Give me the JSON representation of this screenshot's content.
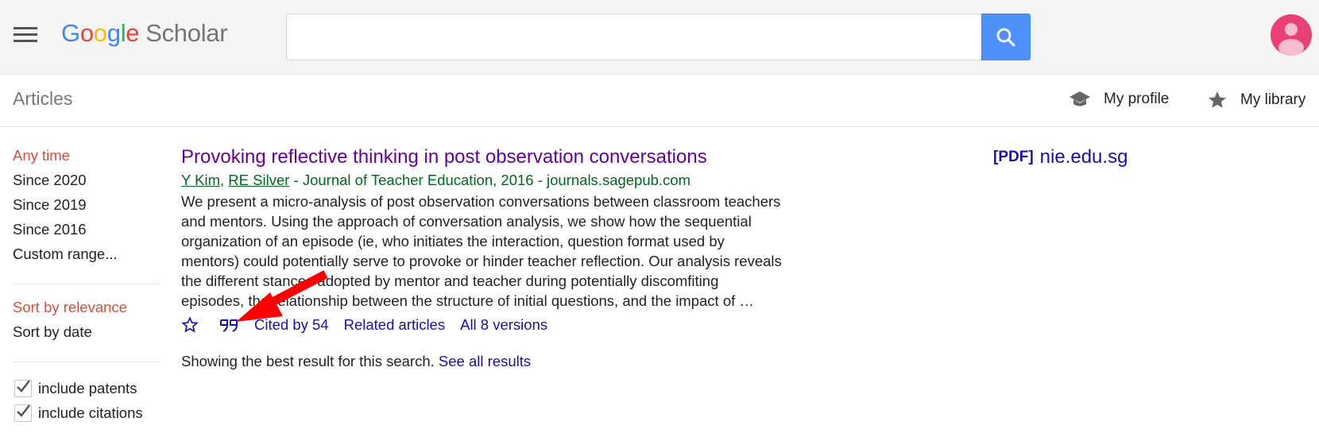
{
  "header": {
    "menu_icon": "hamburger-menu-icon",
    "logo": {
      "google_letters": [
        "G",
        "o",
        "o",
        "g",
        "l",
        "e"
      ],
      "product": "Scholar"
    },
    "search": {
      "value": "",
      "placeholder": ""
    },
    "search_button_icon": "search-icon",
    "avatar_icon": "account-avatar-icon"
  },
  "subheader": {
    "section_label": "Articles",
    "my_profile": {
      "label": "My profile",
      "icon": "graduation-cap-icon"
    },
    "my_library": {
      "label": "My library",
      "icon": "star-icon"
    }
  },
  "sidebar": {
    "time_filters": [
      {
        "label": "Any time",
        "active": true
      },
      {
        "label": "Since 2020",
        "active": false
      },
      {
        "label": "Since 2019",
        "active": false
      },
      {
        "label": "Since 2016",
        "active": false
      },
      {
        "label": "Custom range...",
        "active": false
      }
    ],
    "sort_options": [
      {
        "label": "Sort by relevance",
        "active": true
      },
      {
        "label": "Sort by date",
        "active": false
      }
    ],
    "checkboxes": [
      {
        "label": "include patents",
        "checked": true
      },
      {
        "label": "include citations",
        "checked": true
      }
    ]
  },
  "result": {
    "title": "Provoking reflective thinking in post observation conversations",
    "authors": [
      "Y Kim",
      "RE Silver"
    ],
    "author_separator": ", ",
    "meta_rest": " - Journal of Teacher Education, 2016 - journals.sagepub.com",
    "snippet_lines": [
      "We present a micro-analysis of post observation conversations between classroom teachers",
      "and mentors. Using the approach of conversation analysis, we show how the sequential",
      "organization of an episode (ie, who initiates the interaction, question format used by",
      "mentors) could potentially serve to provoke or hinder teacher reflection. Our analysis reveals",
      "the different stances adopted by mentor and teacher during potentially discomfiting",
      "episodes, the relationship between the structure of initial questions, and the impact of …"
    ],
    "actions": {
      "save_icon": "star-outline-icon",
      "cite_icon": "quote-icon",
      "cited_by": "Cited by 54",
      "related": "Related articles",
      "versions": "All 8 versions"
    },
    "pdf": {
      "tag": "[PDF]",
      "source": "nie.edu.sg"
    }
  },
  "footer_note": {
    "text": "Showing the best result for this search. ",
    "link": "See all results"
  },
  "annotation": {
    "arrow_icon": "red-arrow-pointer",
    "color": "#ff0000"
  },
  "colors": {
    "header_bg": "#f5f5f5",
    "search_button": "#4d90fe",
    "avatar": "#ea4174",
    "active_filter": "#dd4b39",
    "title_visited": "#660099",
    "link": "#1a0dab",
    "meta_green": "#006621"
  }
}
